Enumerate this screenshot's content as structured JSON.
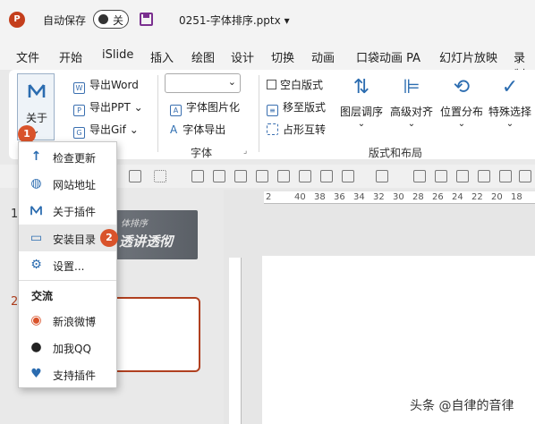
{
  "titlebar": {
    "app_badge": "P",
    "autosave_label": "自动保存",
    "autosave_state": "关",
    "doc_title": "0251-字体排序.pptx",
    "doc_title_caret": "▾"
  },
  "tabs": [
    "文件",
    "开始",
    "iSlide",
    "插入",
    "绘图",
    "设计",
    "切换",
    "动画",
    "口袋动画 PA",
    "幻灯片放映",
    "录制"
  ],
  "ribbon": {
    "about_label": "关于",
    "export_word": "导出Word",
    "export_ppt": "导出PPT",
    "export_gif": "导出Gif",
    "font_img": "字体图片化",
    "font_export": "字体导出",
    "group_font": "字体",
    "blank_layout": "空白版式",
    "move_to_layout": "移至版式",
    "placeholder_swap": "占形互转",
    "layer_order": "图层调序",
    "advanced_align": "高级对齐",
    "position_dist": "位置分布",
    "feature_select": "特殊选择",
    "group_layout": "版式和布局",
    "caret": "⌄"
  },
  "badges": {
    "one": "1",
    "two": "2"
  },
  "menu": {
    "items": [
      {
        "label": "检查更新",
        "icon": "arrow-up-icon"
      },
      {
        "label": "网站地址",
        "icon": "globe-icon"
      },
      {
        "label": "关于插件",
        "icon": "islide-logo-icon"
      },
      {
        "label": "安装目录",
        "icon": "folder-icon"
      },
      {
        "label": "设置...",
        "icon": "gear-icon"
      }
    ],
    "section": "交流",
    "social": [
      {
        "label": "新浪微博",
        "icon": "weibo-icon"
      },
      {
        "label": "加我QQ",
        "icon": "qq-icon"
      },
      {
        "label": "支持插件",
        "icon": "heart-icon"
      }
    ]
  },
  "slides": {
    "num1": "1",
    "num2": "2",
    "slide1_line1": "体排序",
    "slide1_line2": "透讲透彻"
  },
  "ruler": {
    "ticks": [
      "2",
      "40",
      "38",
      "36",
      "34",
      "32",
      "30",
      "28",
      "26",
      "24",
      "22",
      "20",
      "18",
      "16"
    ]
  },
  "watermark": "头条 @自律的音律",
  "colors": {
    "accent": "#d9532b",
    "ppt": "#c43e1c",
    "selection": "#b04020"
  }
}
